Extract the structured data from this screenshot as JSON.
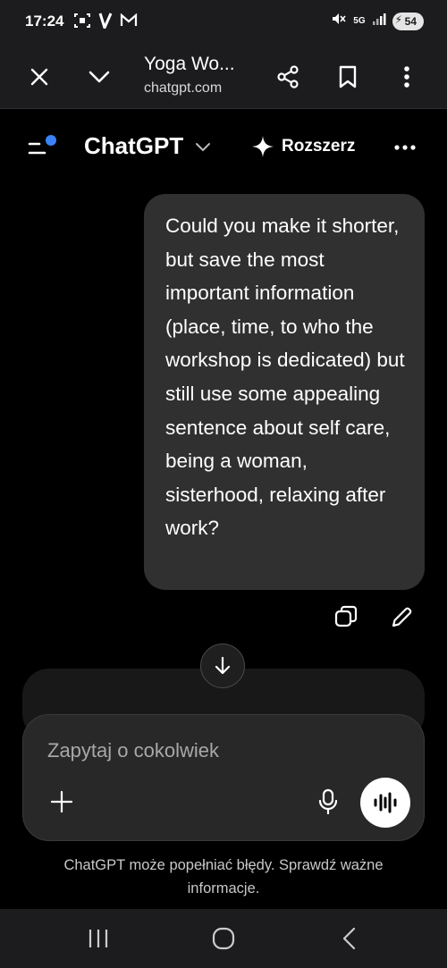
{
  "status_bar": {
    "time": "17:24",
    "network": "5G",
    "battery": "54"
  },
  "browser": {
    "tab_title": "Yoga Wo...",
    "url": "chatgpt.com"
  },
  "header": {
    "title": "ChatGPT",
    "upgrade_label": "Rozszerz",
    "accent_dot_color": "#3b82f6"
  },
  "conversation": {
    "user_message": "Could you make it shorter, but save the most important information (place, time, to who the workshop is dedicated) but still use some appealing sentence about self care, being a woman, sisterhood, relaxing after work?"
  },
  "composer": {
    "placeholder": "Zapytaj o cokolwiek"
  },
  "disclaimer": "ChatGPT może popełniać błędy. Sprawdź ważne informacje.",
  "icons": [
    "screenshot-icon",
    "v-app-icon",
    "gmail-icon",
    "mute-icon",
    "signal-icon",
    "close-icon",
    "chevron-down-icon",
    "share-icon",
    "bookmark-icon",
    "more-vert-icon",
    "sidebar-icon",
    "sparkle-icon",
    "more-horiz-icon",
    "copy-icon",
    "edit-icon",
    "arrow-down-icon",
    "plus-icon",
    "mic-icon",
    "voice-wave-icon",
    "recents-icon",
    "home-icon",
    "back-icon"
  ]
}
